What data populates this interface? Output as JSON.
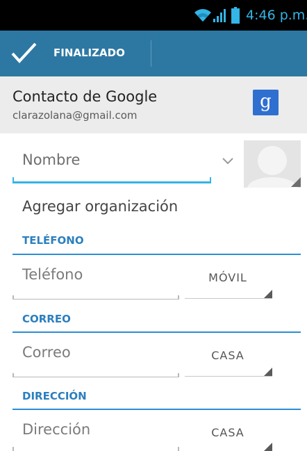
{
  "status_bar": {
    "time": "4:46 p.m.",
    "icons": [
      "wifi-icon",
      "signal-icon",
      "battery-icon"
    ],
    "accent_color": "#33b5e5"
  },
  "action_bar": {
    "done_label": "FINALIZADO",
    "done_icon": "check-icon",
    "background": "#2d78a3"
  },
  "account": {
    "title": "Contacto de Google",
    "email": "clarazolana@gmail.com",
    "logo_letter": "g",
    "logo_color": "#2f6fd0"
  },
  "name": {
    "placeholder": "Nombre",
    "expand_icon": "chevron-down-icon",
    "photo_icon": "person-silhouette-icon"
  },
  "organization": {
    "label": "Agregar organización"
  },
  "sections": {
    "phone": {
      "header": "TELÉFONO",
      "placeholder": "Teléfono",
      "type": "MÓVIL"
    },
    "email": {
      "header": "CORREO",
      "placeholder": "Correo",
      "type": "CASA"
    },
    "address": {
      "header": "DIRECCIÓN",
      "placeholder": "Dirección",
      "type": "CASA"
    }
  }
}
